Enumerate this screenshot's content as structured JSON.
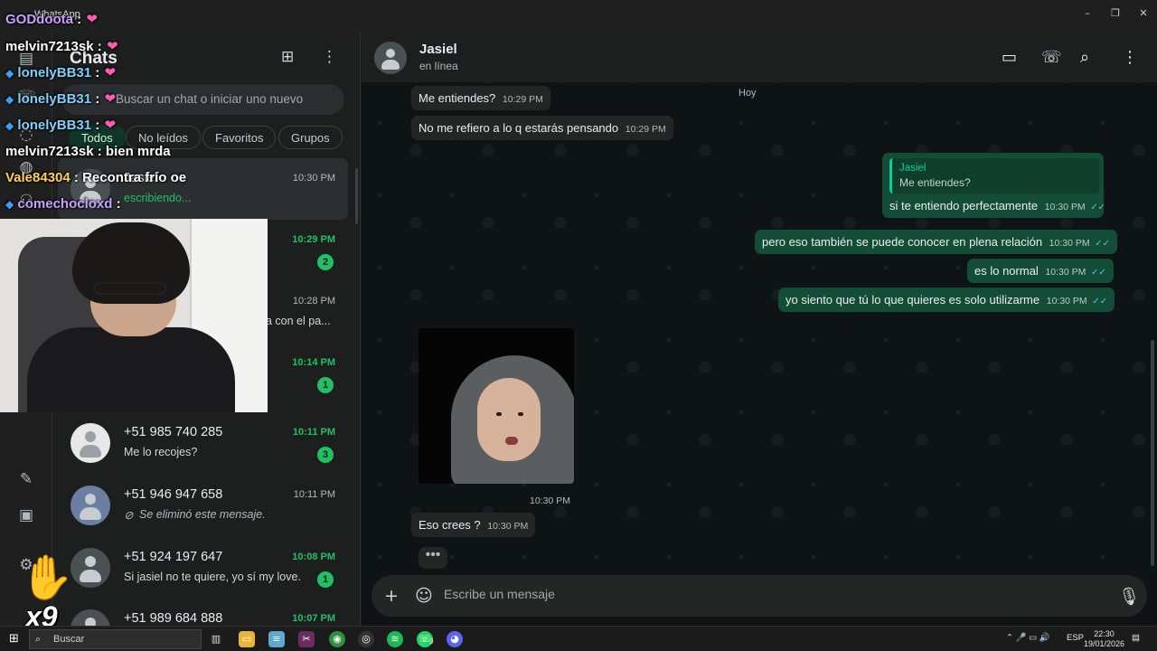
{
  "window": {
    "app_title": "WhatsApp",
    "minimize": "–",
    "maximize": "❐",
    "close": "✕"
  },
  "chat_list": {
    "title": "Chats",
    "new_chat_icon": "new-chat-icon",
    "menu_icon": "menu-dots-icon",
    "search_placeholder": "Buscar un chat o iniciar uno nuevo",
    "filters": [
      "Todos",
      "No leídos",
      "Favoritos",
      "Grupos"
    ],
    "active_filter": "Todos",
    "rows": [
      {
        "name": "Jasiel",
        "preview": "escribiendo...",
        "time": "10:30 PM",
        "unread": null,
        "typing": true,
        "deleted": false,
        "selected": true
      },
      {
        "name": "",
        "preview": "",
        "time": "10:29 PM",
        "unread": "2",
        "typing": false,
        "deleted": false,
        "selected": false
      },
      {
        "name": "",
        "preview": "a con el pa...",
        "time": "10:28 PM",
        "unread": null,
        "typing": false,
        "deleted": false,
        "selected": false
      },
      {
        "name": "",
        "preview": "",
        "time": "10:14 PM",
        "unread": "1",
        "typing": false,
        "deleted": false,
        "selected": false
      },
      {
        "name": "+51 985 740 285",
        "preview": "Me lo recojes?",
        "time": "10:11 PM",
        "unread": "3",
        "typing": false,
        "deleted": false,
        "selected": false
      },
      {
        "name": "+51 946 947 658",
        "preview": "Se eliminó este mensaje.",
        "time": "10:11 PM",
        "unread": null,
        "typing": false,
        "deleted": true,
        "selected": false
      },
      {
        "name": "+51 924 197 647",
        "preview": "Si jasiel no te quiere, yo sí my love.",
        "time": "10:08 PM",
        "unread": "1",
        "typing": false,
        "deleted": false,
        "selected": false
      },
      {
        "name": "+51 989 684 888",
        "preview": "",
        "time": "10:07 PM",
        "unread": null,
        "typing": false,
        "deleted": false,
        "selected": false
      }
    ]
  },
  "chat": {
    "contact_name": "Jasiel",
    "contact_status": "en línea",
    "day_label": "Hoy",
    "messages": [
      {
        "dir": "in",
        "text": "Me entiendes?",
        "time": "10:29 PM"
      },
      {
        "dir": "in",
        "text": "No me refiero a lo q estarás pensando",
        "time": "10:29 PM"
      },
      {
        "dir": "out",
        "quote_name": "Jasiel",
        "quote_text": "Me entiendes?",
        "text": "si te entiendo perfectamente",
        "time": "10:30 PM"
      },
      {
        "dir": "out",
        "text": "pero eso también se puede conocer en plena relación",
        "time": "10:30 PM"
      },
      {
        "dir": "out",
        "text": "es lo normal",
        "time": "10:30 PM"
      },
      {
        "dir": "out",
        "text": "yo siento que tú lo que quieres es solo utilizarme",
        "time": "10:30 PM"
      },
      {
        "dir": "in",
        "type": "image",
        "time": "10:30 PM"
      },
      {
        "dir": "in",
        "text": "Eso crees ?",
        "time": "10:30 PM"
      }
    ],
    "typing_indicator": "•••",
    "composer_placeholder": "Escribe un mensaje",
    "read_ticks": "✓✓"
  },
  "overlay_chat": [
    {
      "user": "GODdoota",
      "sep": " :",
      "msg": " ❤"
    },
    {
      "user": "melvin7213sk",
      "sep": " :",
      "msg": " ❤"
    },
    {
      "user": "lonelyBB31",
      "sep": " :",
      "msg": " ❤"
    },
    {
      "user": "lonelyBB31",
      "sep": " :",
      "msg": " ❤"
    },
    {
      "user": "lonelyBB31",
      "sep": " :",
      "msg": " ❤"
    },
    {
      "user": "melvin7213sk",
      "sep": " :",
      "msg": " bien mrda"
    },
    {
      "user": "Vale84304",
      "sep": " :",
      "msg": " Recontra frío oe"
    },
    {
      "user": "comechocloxd",
      "sep": " :",
      "msg": ""
    }
  ],
  "overlay_combo": "x9",
  "taskbar": {
    "search_label": "Buscar",
    "tray_lang": "ESP",
    "clock_time": "22:30",
    "clock_date": "19/01/2026",
    "whatsapp_badge": "9"
  }
}
